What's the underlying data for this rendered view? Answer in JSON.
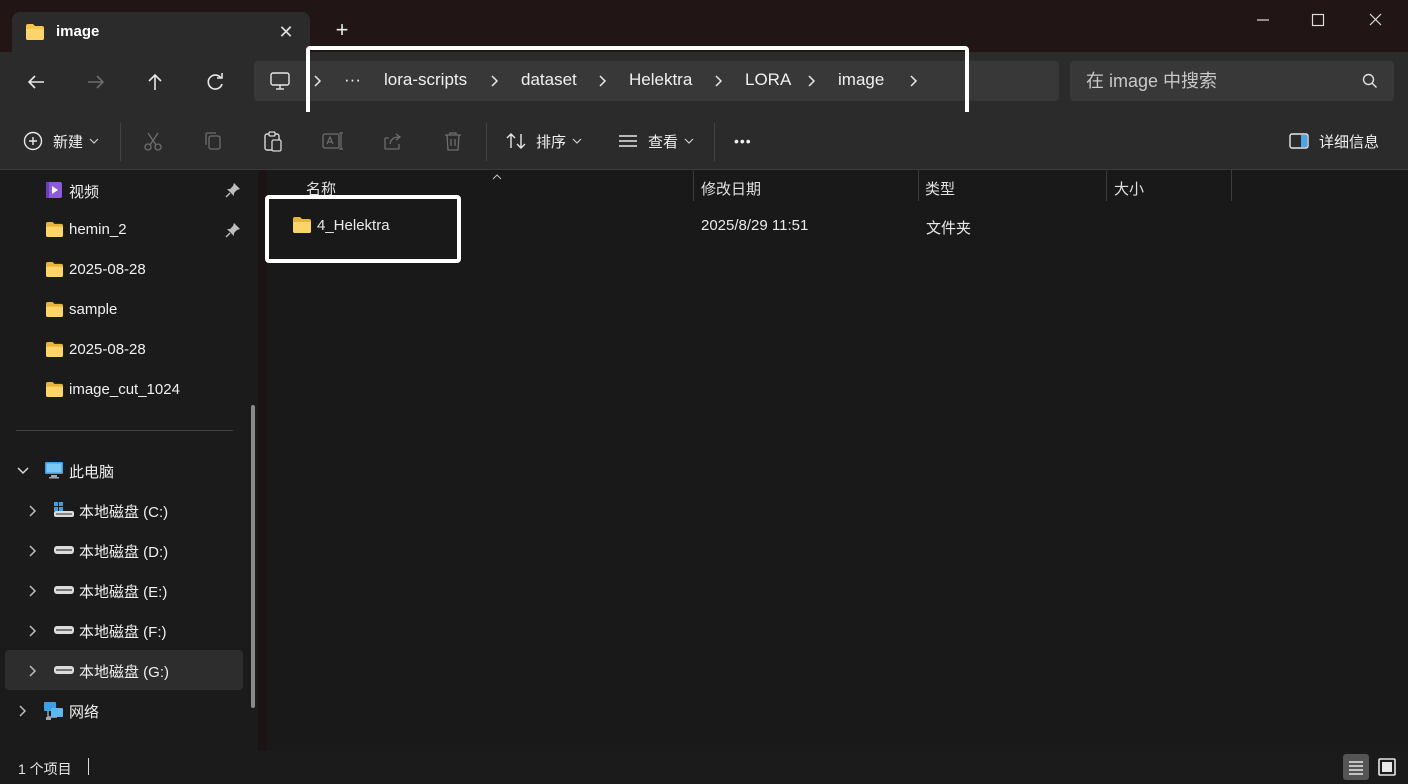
{
  "tab": {
    "title": "image",
    "close_glyph": "✕",
    "newtab_glyph": "+"
  },
  "window_controls": {
    "minimize": "minimize-icon",
    "maximize": "maximize-icon",
    "close": "close-icon"
  },
  "breadcrumb": {
    "overflow": "···",
    "items": [
      "lora-scripts",
      "dataset",
      "Helektra",
      "LORA",
      "image"
    ]
  },
  "search": {
    "placeholder": "在 image 中搜索"
  },
  "toolbar": {
    "new_label": "新建",
    "sort_label": "排序",
    "view_label": "查看",
    "more_label": "•••",
    "details_label": "详细信息"
  },
  "sidebar": {
    "quick_access": [
      {
        "label": "视频",
        "icon": "videos-icon",
        "pinned": true
      },
      {
        "label": "hemin_2",
        "icon": "folder-icon",
        "pinned": true
      },
      {
        "label": "2025-08-28",
        "icon": "folder-icon",
        "pinned": false
      },
      {
        "label": "sample",
        "icon": "folder-icon",
        "pinned": false
      },
      {
        "label": "2025-08-28",
        "icon": "folder-icon",
        "pinned": false
      },
      {
        "label": "image_cut_1024",
        "icon": "folder-icon",
        "pinned": false
      }
    ],
    "this_pc": {
      "label": "此电脑",
      "icon": "this-pc-icon"
    },
    "drives": [
      {
        "label": "本地磁盘 (C:)",
        "icon": "system-drive-icon"
      },
      {
        "label": "本地磁盘 (D:)",
        "icon": "drive-icon"
      },
      {
        "label": "本地磁盘 (E:)",
        "icon": "drive-icon"
      },
      {
        "label": "本地磁盘 (F:)",
        "icon": "drive-icon"
      },
      {
        "label": "本地磁盘 (G:)",
        "icon": "drive-icon",
        "selected": true
      }
    ],
    "network": {
      "label": "网络",
      "icon": "network-icon"
    }
  },
  "columns": {
    "name": "名称",
    "modified": "修改日期",
    "type": "类型",
    "size": "大小"
  },
  "files": [
    {
      "name": "4_Helektra",
      "modified": "2025/8/29 11:51",
      "type": "文件夹",
      "size": ""
    }
  ],
  "status": {
    "count": "1 个项目"
  },
  "colors": {
    "folder": "#f4c44d",
    "background": "#191919",
    "accent": "#ffffff"
  }
}
